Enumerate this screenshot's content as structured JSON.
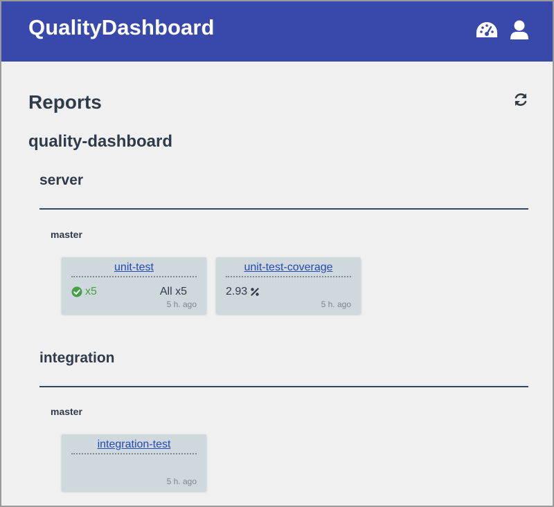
{
  "header": {
    "app_title": "QualityDashboard",
    "icons": [
      "dashboard-icon",
      "user-icon"
    ],
    "background_color": "#3949ab"
  },
  "page": {
    "title": "Reports",
    "refresh_icon": "refresh-icon"
  },
  "project": {
    "name": "quality-dashboard",
    "modules": [
      {
        "name": "server",
        "branches": [
          {
            "name": "master",
            "reports": [
              {
                "name": "unit-test",
                "status_icon": "check-circle-icon",
                "status_text": "x5",
                "total_text": "All x5",
                "time": "5 h. ago"
              },
              {
                "name": "unit-test-coverage",
                "value_text": "2.93",
                "value_icon": "percent-icon",
                "time": "5 h. ago"
              }
            ]
          }
        ]
      },
      {
        "name": "integration",
        "branches": [
          {
            "name": "master",
            "reports": [
              {
                "name": "integration-test",
                "time": "5 h. ago"
              }
            ]
          }
        ]
      }
    ]
  },
  "colors": {
    "accent": "#3949ab",
    "text": "#2e3b4a",
    "card_bg": "#cfd8dd",
    "link": "#2348b8",
    "success": "#43a047"
  }
}
